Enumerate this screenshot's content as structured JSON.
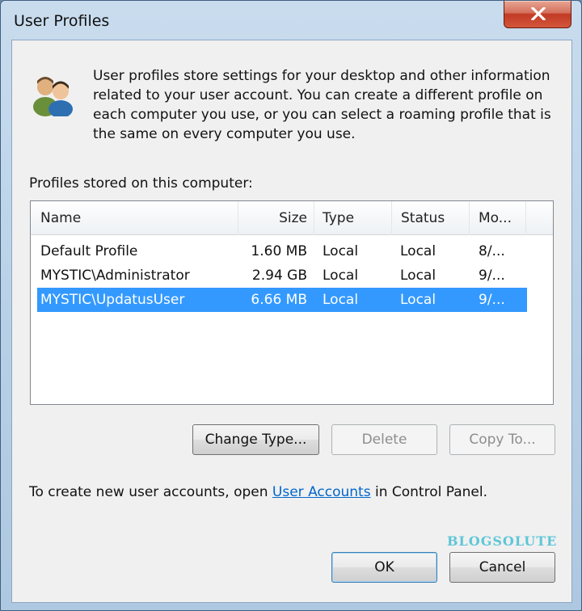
{
  "window": {
    "title": "User Profiles",
    "close_label": "Close"
  },
  "intro_text": "User profiles store settings for your desktop and other information related to your user account. You can create a different profile on each computer you use, or you can select a roaming profile that is the same on every computer you use.",
  "profiles_label": "Profiles stored on this computer:",
  "columns": [
    {
      "label": "Name"
    },
    {
      "label": "Size"
    },
    {
      "label": "Type"
    },
    {
      "label": "Status"
    },
    {
      "label": "Mo..."
    }
  ],
  "profiles": [
    {
      "name": "Default Profile",
      "size": "1.60 MB",
      "type": "Local",
      "status": "Local",
      "modified": "8/...",
      "selected": false
    },
    {
      "name": "MYSTIC\\Administrator",
      "size": "2.94 GB",
      "type": "Local",
      "status": "Local",
      "modified": "9/...",
      "selected": false
    },
    {
      "name": "MYSTIC\\UpdatusUser",
      "size": "6.66 MB",
      "type": "Local",
      "status": "Local",
      "modified": "9/...",
      "selected": true
    }
  ],
  "buttons": {
    "change_type": "Change Type...",
    "delete": "Delete",
    "copy_to": "Copy To...",
    "ok": "OK",
    "cancel": "Cancel"
  },
  "footer": {
    "prefix": "To create new user accounts, open ",
    "link": "User Accounts",
    "suffix": " in Control Panel."
  },
  "watermark": "BLOGSOLUTE",
  "colors": {
    "selection": "#3399ff",
    "link": "#0066cc",
    "close_button": "#c23a24"
  }
}
